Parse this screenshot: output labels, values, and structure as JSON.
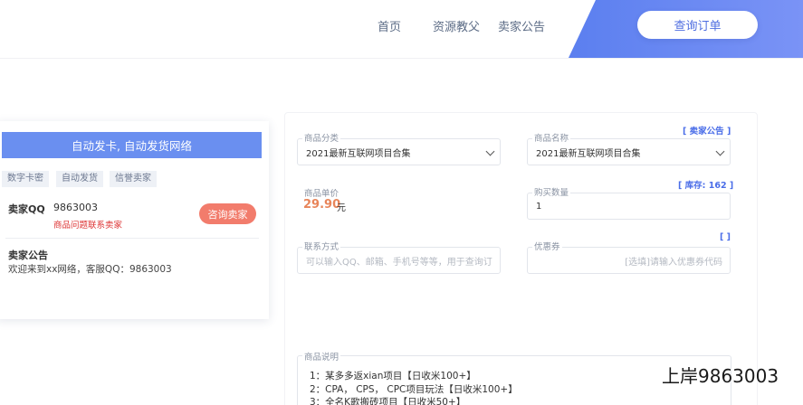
{
  "nav": {
    "items": [
      "首页",
      "资源教父",
      "卖家公告"
    ],
    "order_button": "查询订单"
  },
  "sidebar": {
    "title": "自动发卡, 自动发货网络",
    "tags": [
      "数字卡密",
      "自动发货",
      "信誉卖家"
    ],
    "qq_label": "卖家QQ",
    "qq_number": "9863003",
    "qq_tip": "商品问题联系卖家",
    "consult_button": "咨询卖家",
    "notice_title": "卖家公告",
    "notice_text": "欢迎来到xx网络，客服QQ：9863003"
  },
  "form": {
    "notice_link": "[ 卖家公告 ]",
    "category_label": "商品分类",
    "category_value": "2021最新互联网项目合集",
    "name_label": "商品名称",
    "name_value": "2021最新互联网项目合集",
    "stock_link": "[ 库存: 162 ]",
    "price_label": "商品单价",
    "price_value": "29.90",
    "price_unit": "元",
    "qty_label": "购买数量",
    "qty_value": "1",
    "coupon_link": "[ ]",
    "contact_label": "联系方式",
    "contact_placeholder": "可以输入QQ、邮箱、手机号等等，用于查询订",
    "coupon_label": "优惠券",
    "coupon_placeholder": "[选填]请输入优惠券代码",
    "desc_label": "商品说明",
    "desc_lines": [
      "1：某多多返xian项目【日收米100+】",
      "2：CPA， CPS， CPC项目玩法【日收米100+】",
      "3：全名K歌搬砖项目【日收米50+】"
    ]
  },
  "watermark": "上岸9863003"
}
